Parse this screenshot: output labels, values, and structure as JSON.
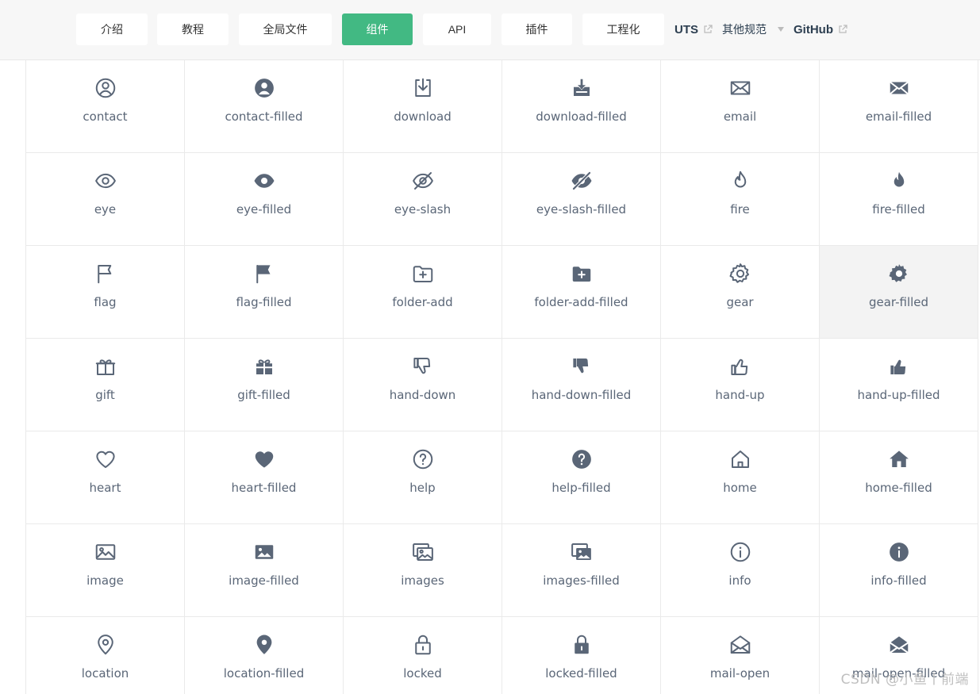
{
  "nav": {
    "items": [
      "介绍",
      "教程",
      "全局文件",
      "组件",
      "API",
      "插件",
      "工程化"
    ],
    "active": "组件",
    "uts": "UTS",
    "other": "其他规范",
    "github": "GitHub"
  },
  "icon_color": "#5a6677",
  "accent_color": "#42b983",
  "icons": [
    {
      "label": "contact",
      "icon": "contact"
    },
    {
      "label": "contact-filled",
      "icon": "contact-filled"
    },
    {
      "label": "download",
      "icon": "download"
    },
    {
      "label": "download-filled",
      "icon": "download-filled"
    },
    {
      "label": "email",
      "icon": "email"
    },
    {
      "label": "email-filled",
      "icon": "email-filled"
    },
    {
      "label": "eye",
      "icon": "eye"
    },
    {
      "label": "eye-filled",
      "icon": "eye-filled"
    },
    {
      "label": "eye-slash",
      "icon": "eye-slash"
    },
    {
      "label": "eye-slash-filled",
      "icon": "eye-slash-filled"
    },
    {
      "label": "fire",
      "icon": "fire"
    },
    {
      "label": "fire-filled",
      "icon": "fire-filled"
    },
    {
      "label": "flag",
      "icon": "flag"
    },
    {
      "label": "flag-filled",
      "icon": "flag-filled"
    },
    {
      "label": "folder-add",
      "icon": "folder-add"
    },
    {
      "label": "folder-add-filled",
      "icon": "folder-add-filled"
    },
    {
      "label": "gear",
      "icon": "gear"
    },
    {
      "label": "gear-filled",
      "icon": "gear-filled",
      "hovered": true
    },
    {
      "label": "gift",
      "icon": "gift"
    },
    {
      "label": "gift-filled",
      "icon": "gift-filled"
    },
    {
      "label": "hand-down",
      "icon": "hand-down"
    },
    {
      "label": "hand-down-filled",
      "icon": "hand-down-filled"
    },
    {
      "label": "hand-up",
      "icon": "hand-up"
    },
    {
      "label": "hand-up-filled",
      "icon": "hand-up-filled"
    },
    {
      "label": "heart",
      "icon": "heart"
    },
    {
      "label": "heart-filled",
      "icon": "heart-filled"
    },
    {
      "label": "help",
      "icon": "help"
    },
    {
      "label": "help-filled",
      "icon": "help-filled"
    },
    {
      "label": "home",
      "icon": "home"
    },
    {
      "label": "home-filled",
      "icon": "home-filled"
    },
    {
      "label": "image",
      "icon": "image"
    },
    {
      "label": "image-filled",
      "icon": "image-filled"
    },
    {
      "label": "images",
      "icon": "images"
    },
    {
      "label": "images-filled",
      "icon": "images-filled"
    },
    {
      "label": "info",
      "icon": "info"
    },
    {
      "label": "info-filled",
      "icon": "info-filled"
    },
    {
      "label": "location",
      "icon": "location"
    },
    {
      "label": "location-filled",
      "icon": "location-filled"
    },
    {
      "label": "locked",
      "icon": "locked"
    },
    {
      "label": "locked-filled",
      "icon": "locked-filled"
    },
    {
      "label": "mail-open",
      "icon": "mail-open"
    },
    {
      "label": "mail-open-filled",
      "icon": "mail-open-filled"
    }
  ],
  "watermark": "CSDN @小鱼丨前端"
}
